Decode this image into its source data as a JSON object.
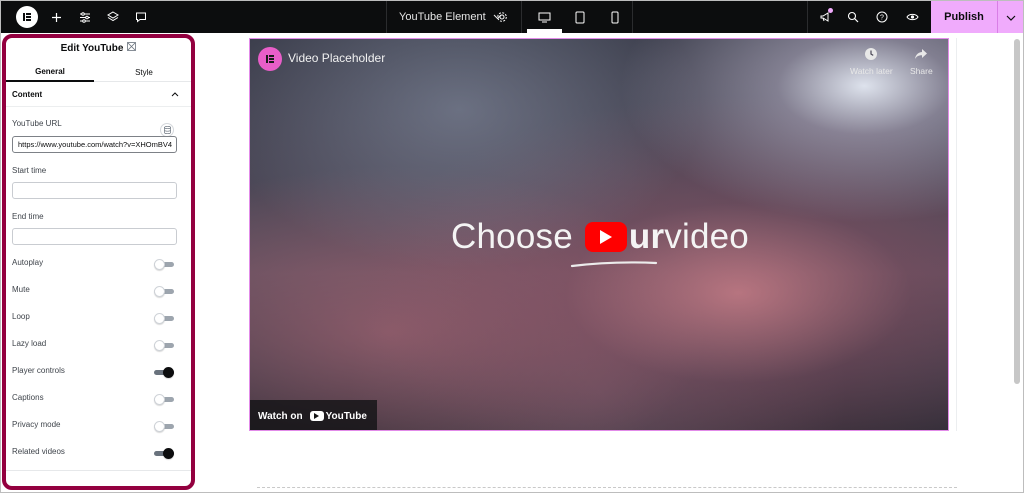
{
  "topbar": {
    "document_title": "YouTube Element",
    "publish_label": "Publish",
    "icons": [
      "elementor-logo-icon",
      "add-icon",
      "settings-sliders-icon",
      "layers-icon",
      "comments-icon",
      "chevron-down-icon",
      "gear-icon",
      "desktop-icon",
      "tablet-icon",
      "mobile-icon",
      "megaphone-icon",
      "search-icon",
      "help-icon",
      "eye-icon",
      "chevron-down-icon"
    ]
  },
  "panel": {
    "title": "Edit YouTube",
    "tabs": [
      {
        "label": "General",
        "active": true
      },
      {
        "label": "Style",
        "active": false
      }
    ],
    "section_title": "Content",
    "fields": {
      "url_label": "YouTube URL",
      "url_value": "https://www.youtube.com/watch?v=XHOmBV4",
      "start_label": "Start time",
      "start_value": "",
      "end_label": "End time",
      "end_value": ""
    },
    "toggles": [
      {
        "label": "Autoplay",
        "on": false
      },
      {
        "label": "Mute",
        "on": false
      },
      {
        "label": "Loop",
        "on": false
      },
      {
        "label": "Lazy load",
        "on": false
      },
      {
        "label": "Player controls",
        "on": true
      },
      {
        "label": "Captions",
        "on": false
      },
      {
        "label": "Privacy mode",
        "on": false
      },
      {
        "label": "Related videos",
        "on": true
      }
    ]
  },
  "video": {
    "title": "Video Placeholder",
    "watch_later_label": "Watch later",
    "share_label": "Share",
    "headline_start": "Choose ",
    "headline_bold": "ur",
    "headline_end": " video",
    "watch_on_label": "Watch on",
    "youtube_label": "YouTube"
  },
  "colors": {
    "accent": "#f0abfc",
    "panel_highlight": "#93003f",
    "topbar": "#0c0d0e",
    "youtube_red": "#ff0000",
    "channel_avatar": "#e95ec9"
  }
}
